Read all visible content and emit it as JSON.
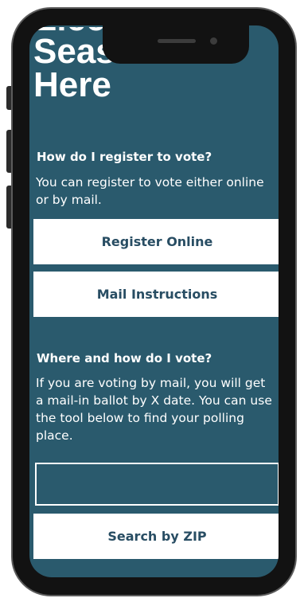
{
  "hero": {
    "title_partial": "Election",
    "title_lines": [
      "Season is",
      "Here"
    ]
  },
  "register": {
    "heading": "How do I register to vote?",
    "text": "You can register to vote either online or by mail.",
    "online_button": "Register Online",
    "mail_button": "Mail Instructions"
  },
  "vote": {
    "heading": "Where and how do I vote?",
    "text": "If you are voting by mail, you will get a mail-in ballot by X date. You can use the tool below to find your polling place.",
    "zip_input_value": "",
    "zip_input_placeholder": "",
    "search_button": "Search by ZIP"
  },
  "colors": {
    "background": "#2a5a6d",
    "button_text": "#284d63",
    "frame": "#121212"
  }
}
